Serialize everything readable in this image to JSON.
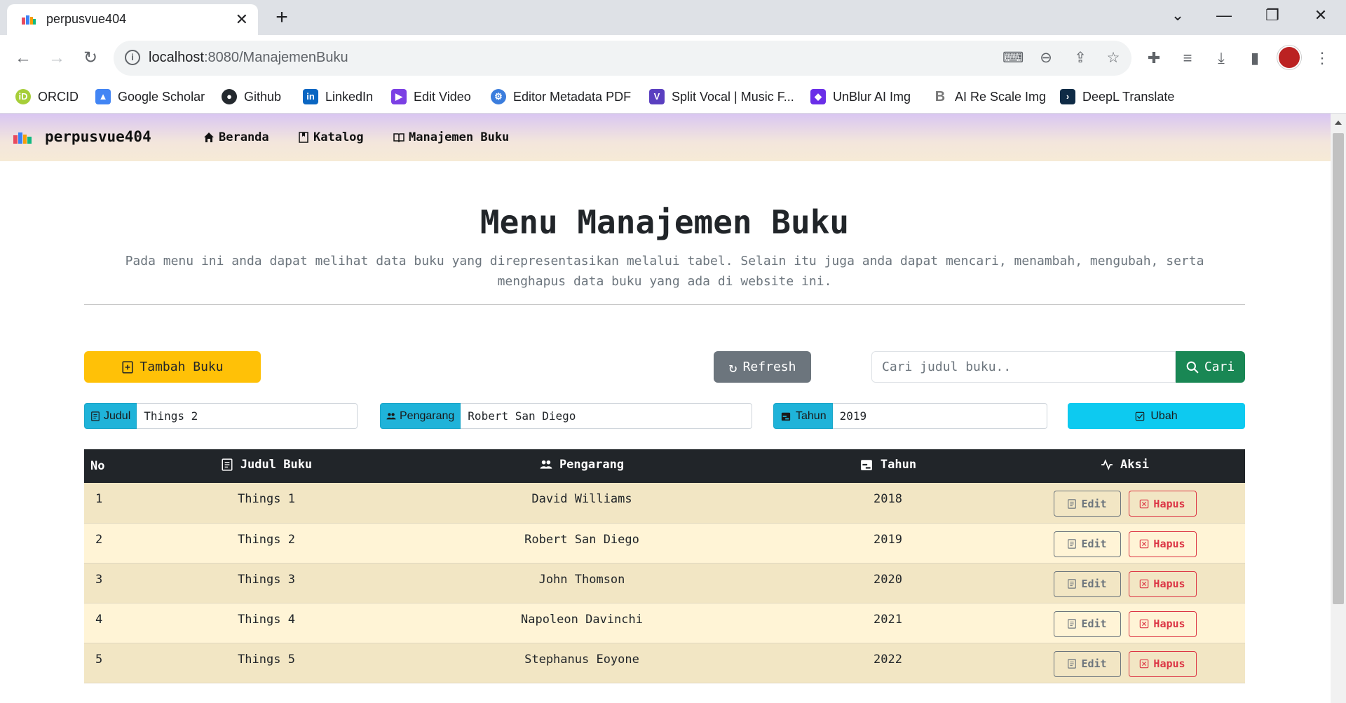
{
  "browser": {
    "tab_title": "perpusvue404",
    "url_host": "localhost",
    "url_rest": ":8080/ManajemenBuku",
    "bookmarks": [
      {
        "label": "ORCID",
        "icon": "orcid-icon",
        "color": "#a6ce39"
      },
      {
        "label": "Google Scholar",
        "icon": "google-scholar-icon",
        "color": "#4285f4"
      },
      {
        "label": "Github",
        "icon": "github-icon",
        "color": "#24292e"
      },
      {
        "label": "LinkedIn",
        "icon": "linkedin-icon",
        "color": "#0a66c2"
      },
      {
        "label": "Edit Video",
        "icon": "clapperboard-icon",
        "color": "#7b3fe4"
      },
      {
        "label": "Editor Metadata PDF",
        "icon": "gears-icon",
        "color": "#3b7ddd"
      },
      {
        "label": "Split Vocal | Music F...",
        "icon": "vocal-remover-icon",
        "color": "#5a3fc0"
      },
      {
        "label": "UnBlur AI Img",
        "icon": "unblur-icon",
        "color": "#6a2ee8"
      },
      {
        "label": "AI Re Scale Img",
        "icon": "bigjpg-icon",
        "color": "#777777"
      },
      {
        "label": "DeepL Translate",
        "icon": "deepl-icon",
        "color": "#0f2b46"
      }
    ]
  },
  "navbar": {
    "brand": "perpusvue404",
    "links": [
      {
        "label": "Beranda",
        "icon": "house-icon"
      },
      {
        "label": "Katalog",
        "icon": "bookmark-book-icon"
      },
      {
        "label": "Manajemen Buku",
        "icon": "open-book-icon"
      }
    ]
  },
  "header": {
    "title": "Menu Manajemen Buku",
    "description": "Pada menu ini anda dapat melihat data buku yang direpresentasikan melalui tabel. Selain itu juga anda dapat mencari, menambah, mengubah, serta menghapus data buku yang ada di website ini."
  },
  "actions": {
    "add_label": "Tambah Buku",
    "refresh_label": "Refresh",
    "search_placeholder": "Cari judul buku..",
    "search_value": "",
    "search_button": "Cari"
  },
  "edit_form": {
    "judul_label": "Judul",
    "judul_value": "Things 2",
    "pengarang_label": "Pengarang",
    "pengarang_value": "Robert San Diego",
    "tahun_label": "Tahun",
    "tahun_value": "2019",
    "submit_label": "Ubah"
  },
  "table": {
    "headers": {
      "no": "No",
      "judul": "Judul Buku",
      "pengarang": "Pengarang",
      "tahun": "Tahun",
      "aksi": "Aksi"
    },
    "edit_label": "Edit",
    "delete_label": "Hapus",
    "rows": [
      {
        "no": "1",
        "judul": "Things 1",
        "pengarang": "David Williams",
        "tahun": "2018"
      },
      {
        "no": "2",
        "judul": "Things 2",
        "pengarang": "Robert San Diego",
        "tahun": "2019"
      },
      {
        "no": "3",
        "judul": "Things 3",
        "pengarang": "John Thomson",
        "tahun": "2020"
      },
      {
        "no": "4",
        "judul": "Things 4",
        "pengarang": "Napoleon Davinchi",
        "tahun": "2021"
      },
      {
        "no": "5",
        "judul": "Things 5",
        "pengarang": "Stephanus Eoyone",
        "tahun": "2022"
      }
    ]
  },
  "colors": {
    "warning": "#ffc107",
    "secondary": "#6c757d",
    "success": "#198754",
    "info": "#0dcaf0",
    "danger": "#dc3545",
    "table_head": "#212529"
  }
}
